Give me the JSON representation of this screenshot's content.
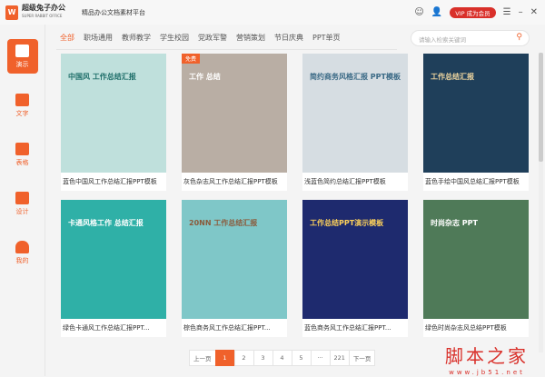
{
  "header": {
    "logo_letter": "W",
    "brand": "超级兔子办公",
    "brand_sub": "SUPER RABBIT OFFICE",
    "platform": "精品办公文档素材平台",
    "vip_label": "VIP 成为会员"
  },
  "sidebar": [
    {
      "label": "演示"
    },
    {
      "label": "文字"
    },
    {
      "label": "表格"
    },
    {
      "label": "设计"
    },
    {
      "label": "我的"
    }
  ],
  "tabs": [
    "全部",
    "职场通用",
    "教师教学",
    "学生校园",
    "党政军警",
    "营销策划",
    "节日庆典",
    "PPT单页"
  ],
  "search": {
    "placeholder": "请输入检索关键词"
  },
  "cards": [
    {
      "title": "蓝色中国风工作总结汇报PPT模板",
      "thumb_text": "中国风 工作总结汇报",
      "color": "#bfe0dc",
      "fg": "#1f6f6a"
    },
    {
      "title": "灰色杂志风工作总结汇报PPT模板",
      "thumb_text": "工作 总结",
      "badge": "免费",
      "color": "#b9aea4",
      "fg": "#fff"
    },
    {
      "title": "浅蓝色简约总结汇报PPT模板",
      "thumb_text": "简约商务风格汇报 PPT模板",
      "color": "#d6dde2",
      "fg": "#3b6a86"
    },
    {
      "title": "蓝色手绘中国风总结汇报PPT模板",
      "thumb_text": "工作总结汇报",
      "color": "#1f3f5a",
      "fg": "#f0d7a0"
    },
    {
      "title": "绿色卡通风工作总结汇报PPT...",
      "thumb_text": "卡通风格工作 总结汇报",
      "color": "#2fb0a7",
      "fg": "#fff"
    },
    {
      "title": "棕色商务风工作总结汇报PPT...",
      "thumb_text": "20NN 工作总结汇报",
      "color": "#7fc7c8",
      "fg": "#8a5a3b"
    },
    {
      "title": "蓝色商务风工作总结汇报PPT...",
      "thumb_text": "工作总结PPT演示模板",
      "color": "#1e2a6e",
      "fg": "#ffd25a"
    },
    {
      "title": "绿色时尚杂志风总结PPT模板",
      "thumb_text": "时尚杂志 PPT",
      "color": "#4f7a58",
      "fg": "#fff"
    }
  ],
  "pagination": [
    "上一页",
    "1",
    "2",
    "3",
    "4",
    "5",
    "···",
    "221",
    "下一页"
  ],
  "watermark": {
    "title": "脚本之家",
    "url": "www.jb51.net"
  }
}
